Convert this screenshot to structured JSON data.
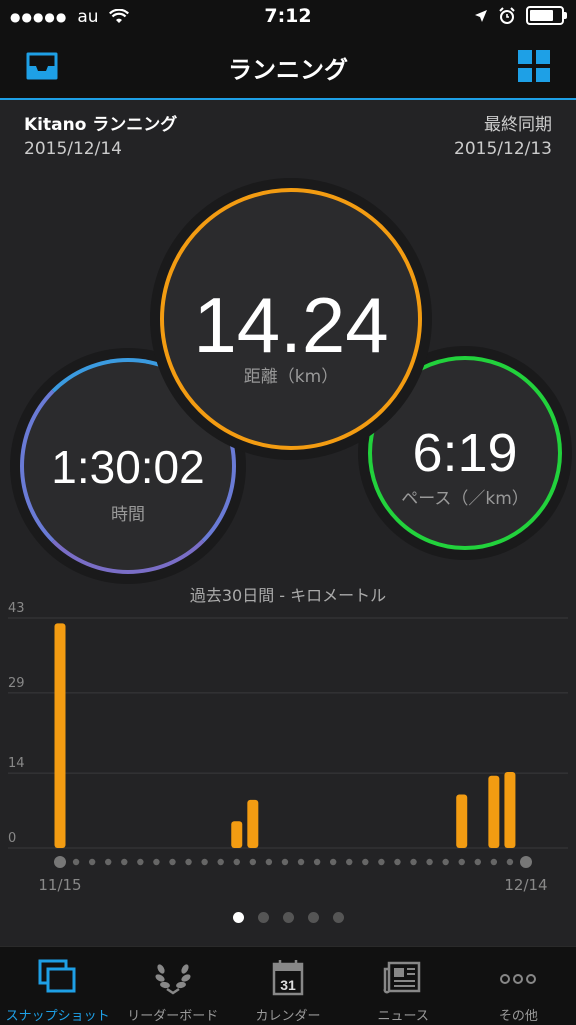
{
  "status": {
    "carrier": "au",
    "signal_dots": "●●●●●",
    "time": "7:12",
    "battery_level": 0.9
  },
  "nav": {
    "title": "ランニング",
    "left_icon": "inbox-icon",
    "right_icon": "grid-icon"
  },
  "header": {
    "activity_name": "Kitano ランニング",
    "activity_date": "2015/12/14",
    "sync_label": "最終同期",
    "sync_date": "2015/12/13"
  },
  "stats": {
    "distance": {
      "value": "14.24",
      "label": "距離（km）",
      "color": "#f39c12"
    },
    "time": {
      "value": "1:30:02",
      "label": "時間",
      "color": "#6a7bd6"
    },
    "pace": {
      "value": "6:19",
      "label": "ペース（／km）",
      "color": "#22d23c"
    }
  },
  "chart_title": "過去30日間 - キロメートル",
  "chart_data": {
    "type": "bar",
    "title": "過去30日間 - キロメートル",
    "yticks": [
      0,
      14,
      29,
      43
    ],
    "ylim": [
      0,
      43
    ],
    "x_start_label": "11/15",
    "x_end_label": "12/14",
    "days": 30,
    "values": [
      42,
      0,
      0,
      0,
      0,
      0,
      0,
      0,
      0,
      0,
      0,
      5,
      9,
      0,
      0,
      0,
      0,
      0,
      0,
      0,
      0,
      0,
      0,
      0,
      0,
      10,
      0,
      13.5,
      14.2,
      0
    ],
    "bar_color": "#f39c12",
    "grid": true
  },
  "pager": {
    "count": 5,
    "active": 0
  },
  "tabs": [
    {
      "label": "スナップショット",
      "icon": "snapshot-icon",
      "active": true
    },
    {
      "label": "リーダーボード",
      "icon": "laurel-icon",
      "active": false
    },
    {
      "label": "カレンダー",
      "icon": "calendar-icon",
      "calendar_day": "31",
      "active": false
    },
    {
      "label": "ニュース",
      "icon": "newspaper-icon",
      "active": false
    },
    {
      "label": "その他",
      "icon": "more-icon",
      "active": false
    }
  ]
}
